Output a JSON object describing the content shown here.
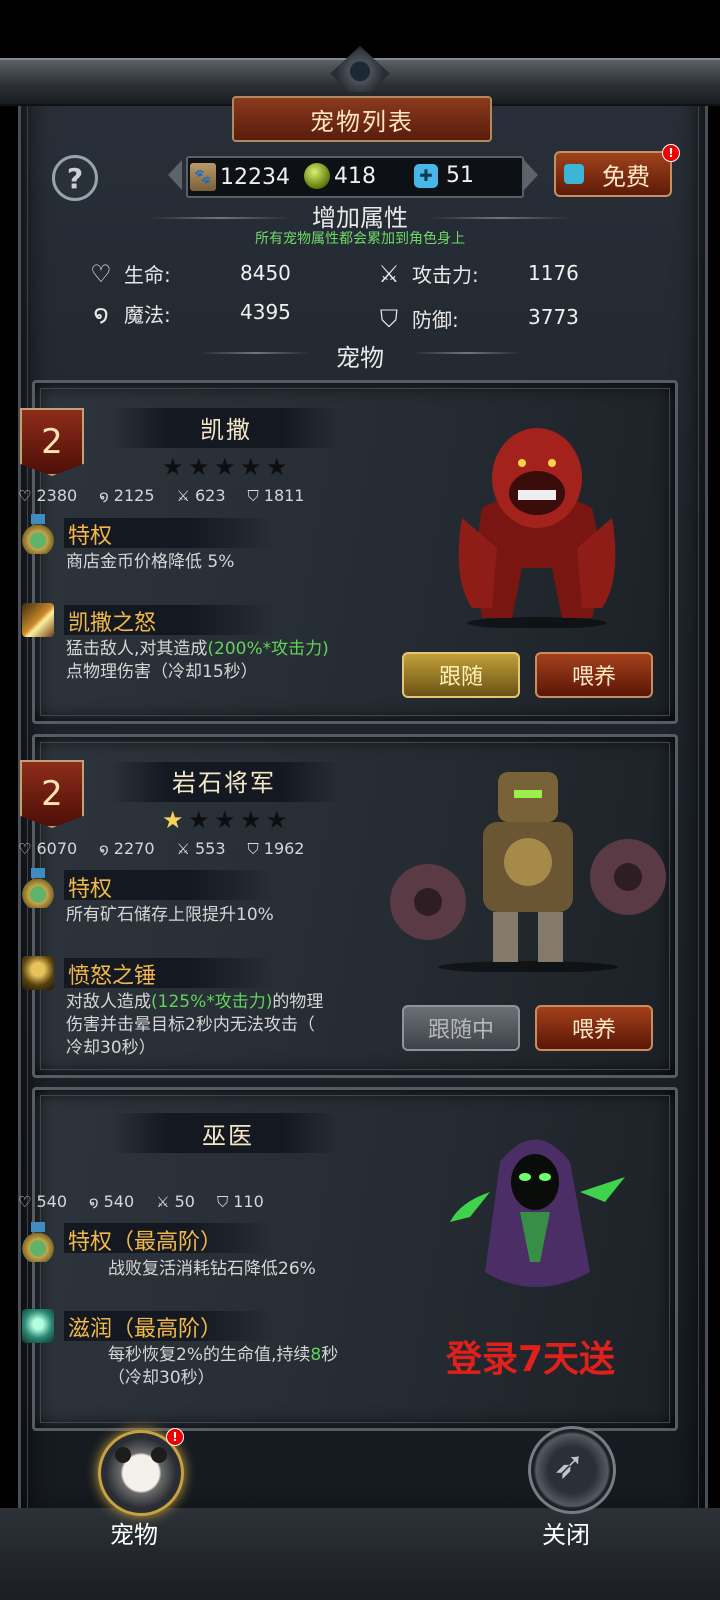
{
  "header": {
    "title": "宠物列表"
  },
  "resources": {
    "food": "12234",
    "orb": "418",
    "puzzle": "51",
    "free_label": "免费",
    "free_badge": "!"
  },
  "attributes": {
    "section_title": "增加属性",
    "note": "所有宠物属性都会累加到角色身上",
    "hp_label": "生命:",
    "hp_value": "8450",
    "mp_label": "魔法:",
    "mp_value": "4395",
    "atk_label": "攻击力:",
    "atk_value": "1176",
    "def_label": "防御:",
    "def_value": "3773"
  },
  "pets_section_title": "宠物",
  "pets": [
    {
      "rank": "2",
      "name": "凯撒",
      "stars": 0,
      "hp": "2380",
      "mp": "2125",
      "atk": "623",
      "def": "1811",
      "perk_title": "特权",
      "perk_desc": "商店金币价格降低 5%",
      "skill_title": "凯撒之怒",
      "skill_desc_1": "猛击敌人,对其造成",
      "skill_desc_hl": "(200%*攻击力)",
      "skill_desc_2": "点物理伤害（冷却15秒）",
      "follow_label": "跟随",
      "feed_label": "喂养"
    },
    {
      "rank": "2",
      "name": "岩石将军",
      "stars": 1,
      "hp": "6070",
      "mp": "2270",
      "atk": "553",
      "def": "1962",
      "perk_title": "特权",
      "perk_desc": "所有矿石储存上限提升10%",
      "skill_title": "愤怒之锤",
      "skill_desc_1": "对敌人造成",
      "skill_desc_hl": "(125%*攻击力)",
      "skill_desc_2": "的物理",
      "skill_desc_3": "伤害并击晕目标2秒内无法攻击（",
      "skill_desc_4": "冷却30秒）",
      "follow_label": "跟随中",
      "feed_label": "喂养"
    },
    {
      "name": "巫医",
      "hp": "540",
      "mp": "540",
      "atk": "50",
      "def": "110",
      "perk_title": "特权（最高阶）",
      "perk_desc": "战败复活消耗钻石降低26%",
      "skill_title": "滋润（最高阶）",
      "skill_desc_1": "每秒恢复2%的生命值,持续",
      "skill_desc_hl": "8",
      "skill_desc_2": "秒",
      "skill_desc_3": "（冷却30秒）",
      "promo": "登录7天送"
    }
  ],
  "bottom": {
    "pet_tab_label": "宠物",
    "pet_badge": "!",
    "close_label": "关闭"
  }
}
